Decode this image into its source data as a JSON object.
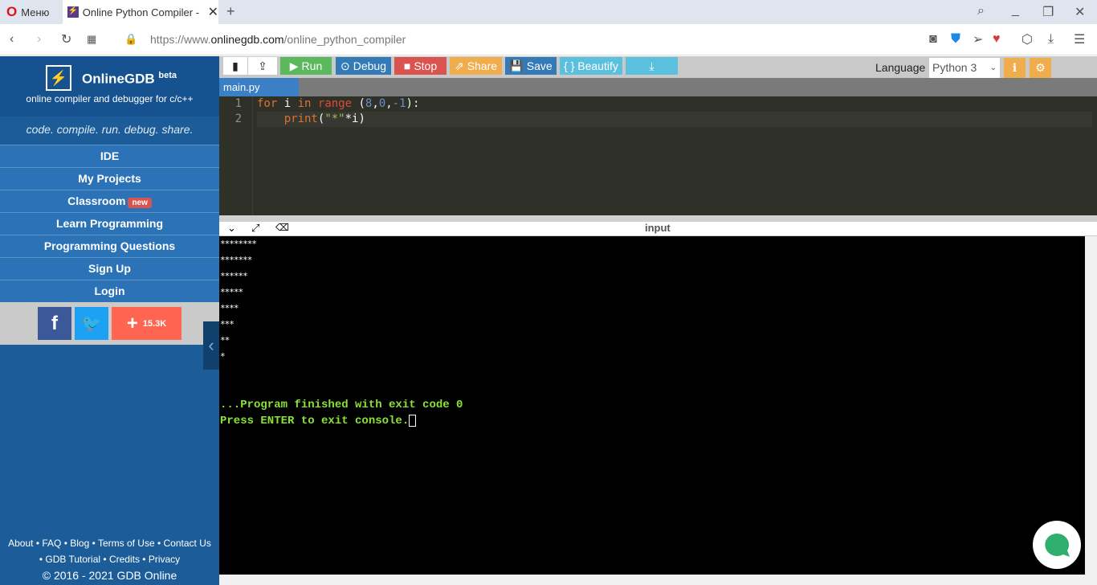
{
  "browser": {
    "menu_label": "Меню",
    "tab_title": "Online Python Compiler - o",
    "url_prefix": "https://www.",
    "url_domain": "onlinegdb.com",
    "url_path": "/online_python_compiler"
  },
  "sidebar": {
    "brand": "OnlineGDB",
    "beta": "beta",
    "subtitle": "online compiler and debugger for c/c++",
    "tagline": "code. compile. run. debug. share.",
    "nav": [
      "IDE",
      "My Projects",
      "Classroom",
      "Learn Programming",
      "Programming Questions",
      "Sign Up",
      "Login"
    ],
    "new_badge": "new",
    "share_count": "15.3K",
    "footer": {
      "line1": [
        "About",
        "FAQ",
        "Blog",
        "Terms of Use",
        "Contact Us"
      ],
      "line2": [
        "GDB Tutorial",
        "Credits",
        "Privacy"
      ],
      "copyright": "© 2016 - 2021 GDB Online"
    }
  },
  "toolbar": {
    "run": "Run",
    "debug": "Debug",
    "stop": "Stop",
    "share": "Share",
    "save": "Save",
    "beautify": "{ } Beautify",
    "language_label": "Language",
    "language": "Python 3"
  },
  "file_tab": "main.py",
  "code": {
    "line_numbers": [
      "1",
      "2"
    ]
  },
  "output": {
    "header": "input",
    "stars": [
      "********",
      "*******",
      "******",
      "*****",
      "****",
      "***",
      "**",
      "*"
    ],
    "finished": "...Program finished with exit code 0",
    "press": "Press ENTER to exit console."
  },
  "colors": {
    "sidebar": "#1c5d99",
    "run": "#5cb85c",
    "debug": "#337ab7",
    "stop": "#d9534f",
    "share": "#f0ad4e"
  }
}
